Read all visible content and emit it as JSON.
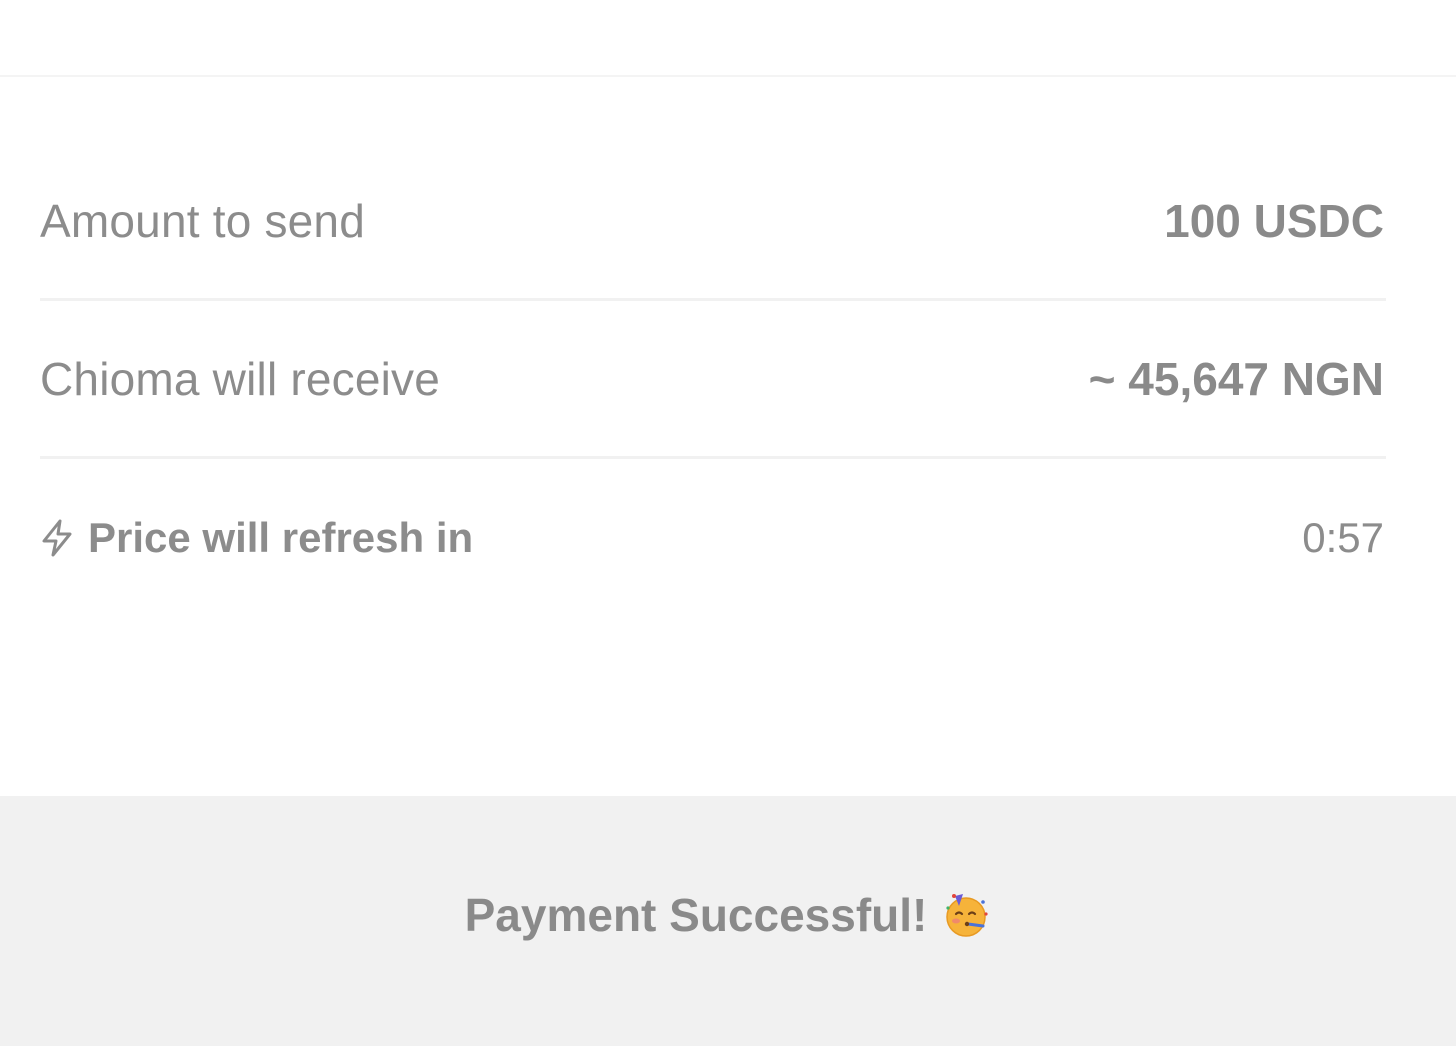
{
  "quote": {
    "amount_label": "Amount to send",
    "amount_value": "100 USDC",
    "receive_label": "Chioma will receive",
    "receive_value": "~ 45,647 NGN",
    "refresh_label": "Price will refresh in",
    "refresh_timer": "0:57"
  },
  "footer": {
    "message": "Payment Successful!"
  },
  "icons": {
    "refresh": "lightning-bolt-icon",
    "celebration": "partying-face-icon"
  },
  "colors": {
    "text": "#8a8a8a",
    "divider": "#f1f1f1",
    "footer_bg": "#f1f1f1",
    "background": "#ffffff"
  }
}
